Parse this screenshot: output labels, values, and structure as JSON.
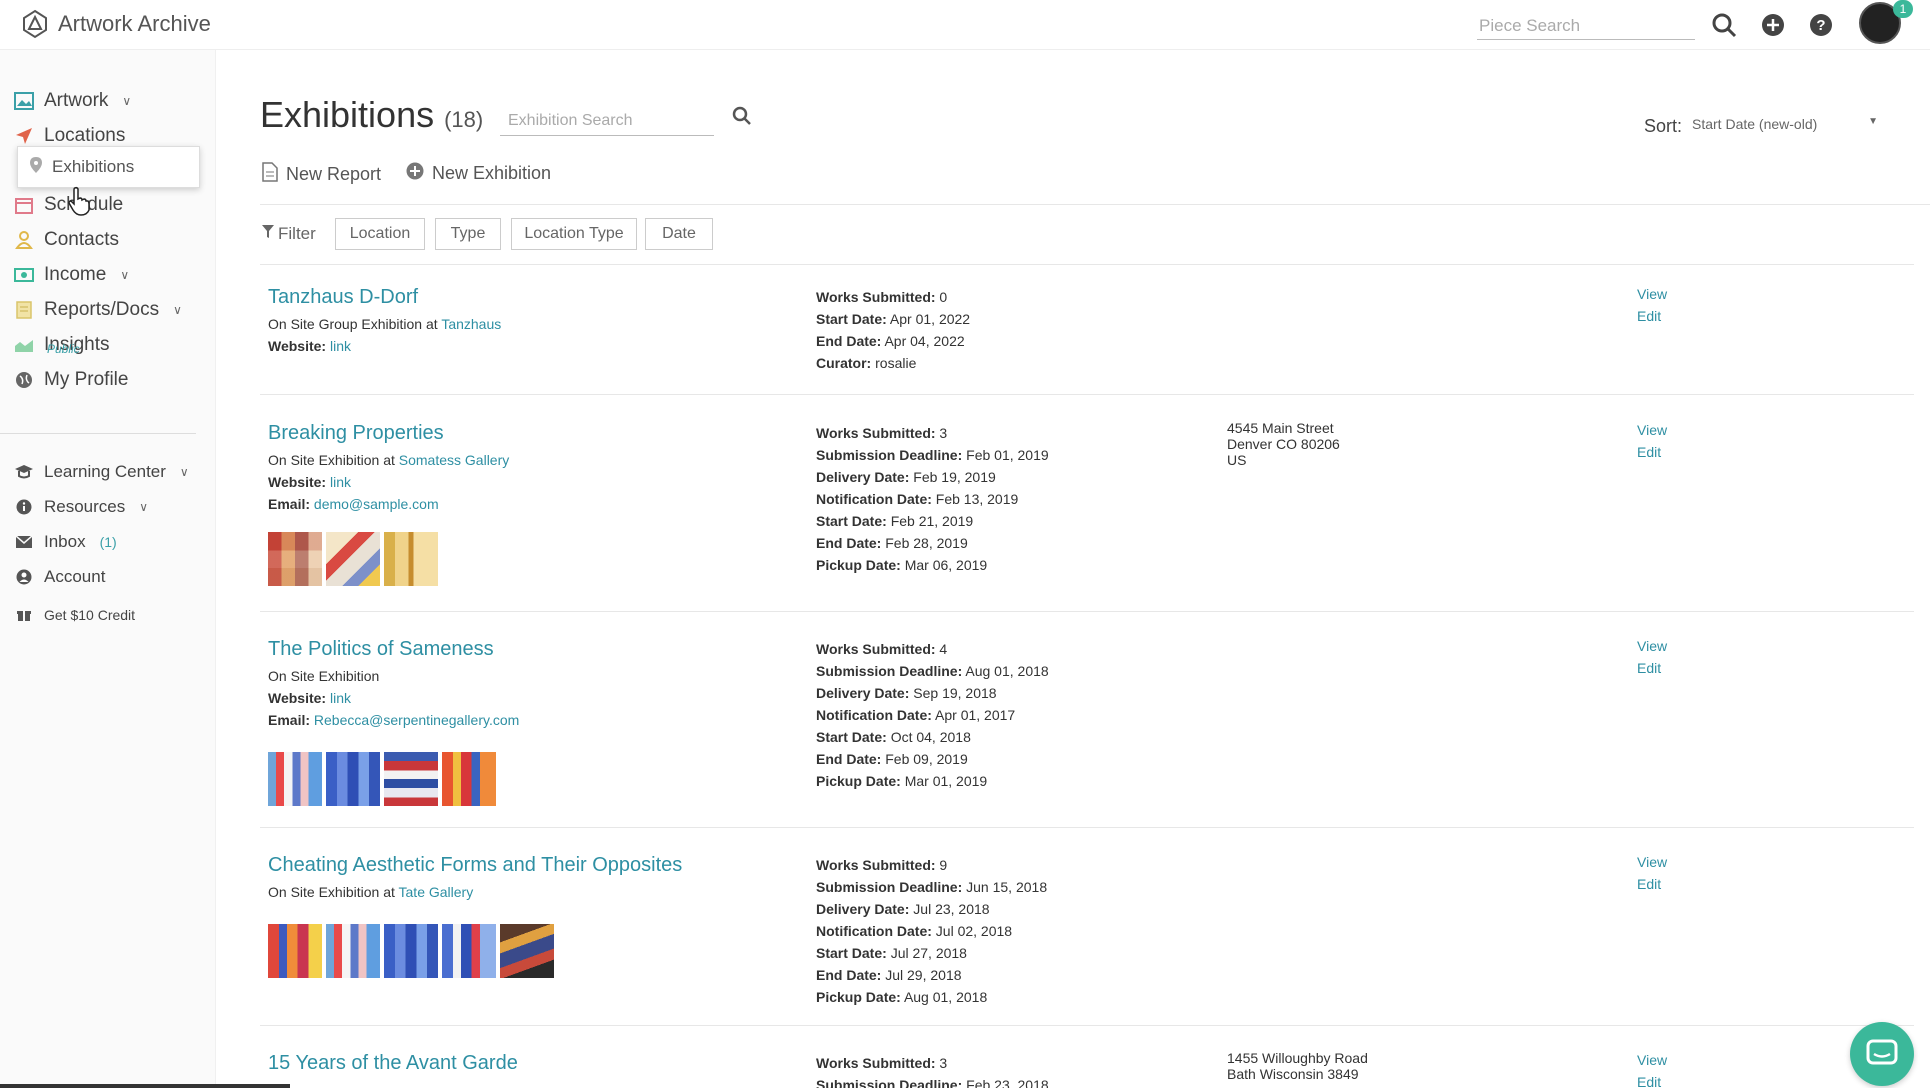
{
  "app": {
    "title": "Artwork Archive"
  },
  "header": {
    "search_placeholder": "Piece Search",
    "notif_count": "1"
  },
  "sidebar": {
    "items": [
      {
        "label": "Artwork"
      },
      {
        "label": "Locations"
      },
      {
        "label": "Schedule"
      },
      {
        "label": "Contacts"
      },
      {
        "label": "Income"
      },
      {
        "label": "Reports/Docs"
      },
      {
        "label": "Insights"
      },
      {
        "label": "My Profile"
      }
    ],
    "profile_sub": "Public",
    "bottom_items": [
      {
        "label": "Learning Center"
      },
      {
        "label": "Resources"
      },
      {
        "label": "Inbox"
      },
      {
        "label": "Account"
      },
      {
        "label": "Get $10 Credit"
      }
    ],
    "inbox_count": "(1)",
    "dropdown_item": "Exhibitions"
  },
  "page": {
    "title": "Exhibitions",
    "count": "(18)",
    "search_placeholder": "Exhibition Search",
    "sort_label": "Sort:",
    "sort_value": "Start Date (new-old)",
    "actions": {
      "new_report": "New Report",
      "new_exhibition": "New Exhibition"
    },
    "filter_label": "Filter",
    "filters": [
      "Location",
      "Type",
      "Location Type",
      "Date"
    ]
  },
  "labels": {
    "website": "Website:",
    "email": "Email:",
    "link": "link",
    "at": "at",
    "view": "View",
    "edit": "Edit"
  },
  "exhibitions": [
    {
      "title": "Tanzhaus D-Dorf",
      "type": "On Site Group Exhibition",
      "venue": "Tanzhaus",
      "website": "link",
      "details": [
        {
          "k": "Works Submitted:",
          "v": "0"
        },
        {
          "k": "Start Date:",
          "v": "Apr 01, 2022"
        },
        {
          "k": "End Date:",
          "v": "Apr 04, 2022"
        },
        {
          "k": "Curator:",
          "v": "rosalie"
        }
      ]
    },
    {
      "title": "Breaking Properties",
      "type": "On Site Exhibition",
      "venue": "Somatess Gallery",
      "website": "link",
      "email": "demo@sample.com",
      "address": [
        "4545 Main Street",
        "Denver CO 80206",
        "US"
      ],
      "details": [
        {
          "k": "Works Submitted:",
          "v": "3"
        },
        {
          "k": "Submission Deadline:",
          "v": "Feb 01, 2019"
        },
        {
          "k": "Delivery Date:",
          "v": "Feb 19, 2019"
        },
        {
          "k": "Notification Date:",
          "v": "Feb 13, 2019"
        },
        {
          "k": "Start Date:",
          "v": "Feb 21, 2019"
        },
        {
          "k": "End Date:",
          "v": "Feb 28, 2019"
        },
        {
          "k": "Pickup Date:",
          "v": "Mar 06, 2019"
        }
      ]
    },
    {
      "title": "The Politics of Sameness",
      "type": "On Site Exhibition",
      "website": "link",
      "email": "Rebecca@serpentinegallery.com",
      "details": [
        {
          "k": "Works Submitted:",
          "v": "4"
        },
        {
          "k": "Submission Deadline:",
          "v": "Aug 01, 2018"
        },
        {
          "k": "Delivery Date:",
          "v": "Sep 19, 2018"
        },
        {
          "k": "Notification Date:",
          "v": "Apr 01, 2017"
        },
        {
          "k": "Start Date:",
          "v": "Oct 04, 2018"
        },
        {
          "k": "End Date:",
          "v": "Feb 09, 2019"
        },
        {
          "k": "Pickup Date:",
          "v": "Mar 01, 2019"
        }
      ]
    },
    {
      "title": "Cheating Aesthetic Forms and Their Opposites",
      "type": "On Site Exhibition",
      "venue": "Tate Gallery",
      "details": [
        {
          "k": "Works Submitted:",
          "v": "9"
        },
        {
          "k": "Submission Deadline:",
          "v": "Jun 15, 2018"
        },
        {
          "k": "Delivery Date:",
          "v": "Jul 23, 2018"
        },
        {
          "k": "Notification Date:",
          "v": "Jul 02, 2018"
        },
        {
          "k": "Start Date:",
          "v": "Jul 27, 2018"
        },
        {
          "k": "End Date:",
          "v": "Jul 29, 2018"
        },
        {
          "k": "Pickup Date:",
          "v": "Aug 01, 2018"
        }
      ]
    },
    {
      "title": "15 Years of the Avant Garde",
      "address": [
        "1455 Willoughby Road",
        "Bath Wisconsin 3849"
      ],
      "details": [
        {
          "k": "Works Submitted:",
          "v": "3"
        },
        {
          "k": "Submission Deadline:",
          "v": "Feb 23, 2018"
        }
      ]
    }
  ],
  "colors": {
    "accent": "#2e8fa3",
    "brand": "#3bb89a"
  }
}
